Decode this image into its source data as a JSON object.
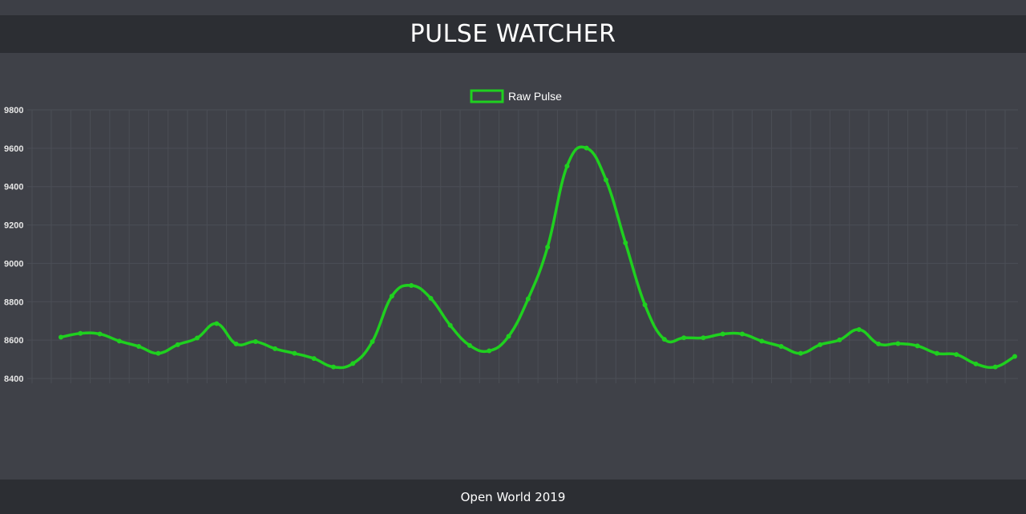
{
  "header": {
    "title": "PULSE WATCHER"
  },
  "footer": {
    "text": "Open World 2019"
  },
  "colors": {
    "line": "#1fd01f",
    "grid": "#4b4e56",
    "axis_text": "#e6e6e6",
    "background": "#3f4148",
    "header": "#2c2e33"
  },
  "chart_data": {
    "type": "line",
    "title": "",
    "xlabel": "",
    "ylabel": "",
    "ylim": [
      8400,
      9800
    ],
    "yticks": [
      9800,
      9600,
      9400,
      9200,
      9000,
      8800,
      8600,
      8400
    ],
    "grid": true,
    "legend_position": "top-center",
    "x_tick_labels_shown": false,
    "series": [
      {
        "name": "Raw Pulse",
        "values": [
          8615,
          8635,
          8632,
          8595,
          8567,
          8531,
          8576,
          8611,
          8686,
          8580,
          8592,
          8555,
          8531,
          8504,
          8460,
          8478,
          8592,
          8829,
          8885,
          8818,
          8677,
          8572,
          8544,
          8620,
          8815,
          9085,
          9507,
          9601,
          9435,
          9107,
          8784,
          8604,
          8612,
          8612,
          8632,
          8632,
          8595,
          8567,
          8531,
          8576,
          8601,
          8655,
          8580,
          8582,
          8570,
          8531,
          8525,
          8476,
          8460,
          8515
        ]
      }
    ]
  }
}
